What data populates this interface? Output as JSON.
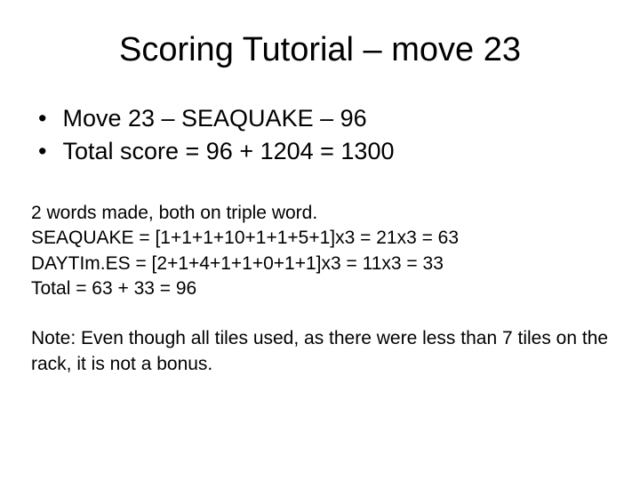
{
  "title": "Scoring Tutorial – move 23",
  "bullets": [
    "Move 23 – SEAQUAKE – 96",
    "Total score = 96 + 1204 = 1300"
  ],
  "details": [
    "2 words made, both on triple word.",
    "SEAQUAKE = [1+1+1+10+1+1+5+1]x3 = 21x3 = 63",
    "DAYTIm.ES = [2+1+4+1+1+0+1+1]x3 =  11x3 = 33",
    "Total = 63 + 33 = 96"
  ],
  "note": "Note: Even though all tiles used, as there were less than 7 tiles on the rack, it is not a bonus."
}
